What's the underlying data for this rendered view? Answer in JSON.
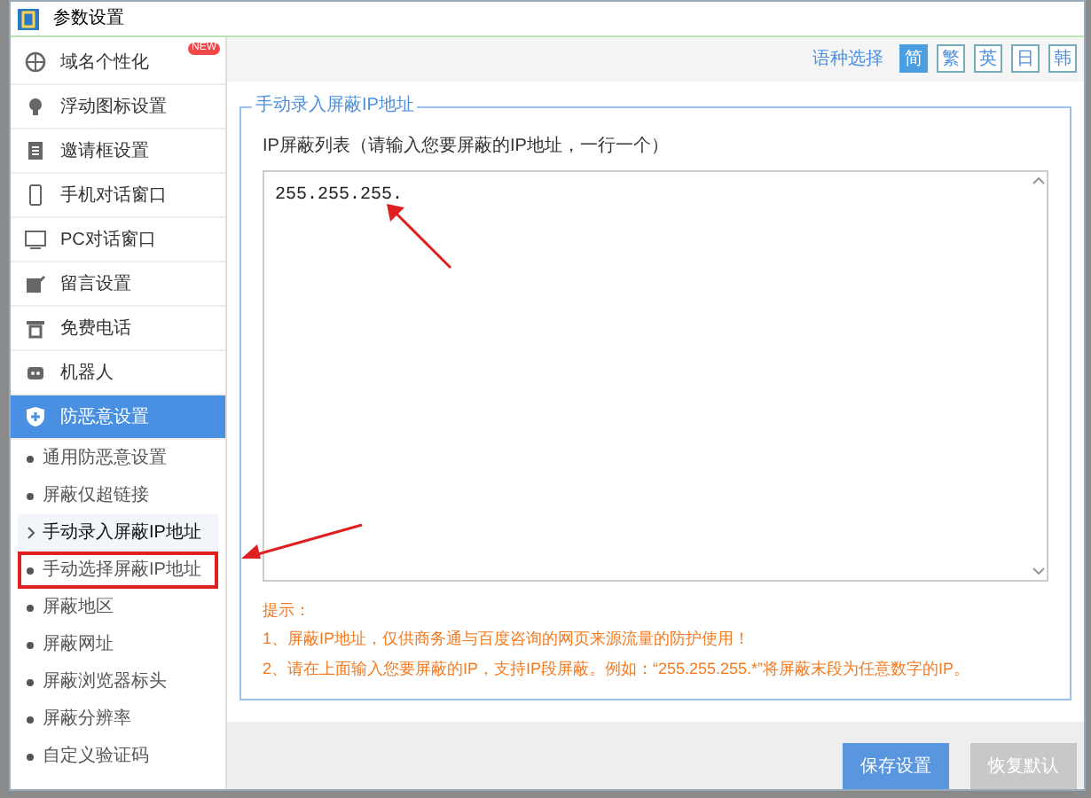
{
  "window": {
    "title": "参数设置"
  },
  "sidebar": {
    "items": [
      {
        "label": "域名个性化",
        "badge": "NEW",
        "expanded": false
      },
      {
        "label": "浮动图标设置",
        "expanded": false
      },
      {
        "label": "邀请框设置",
        "expanded": false
      },
      {
        "label": "手机对话窗口",
        "expanded": false
      },
      {
        "label": "PC对话窗口",
        "expanded": false
      },
      {
        "label": "留言设置",
        "expanded": false
      },
      {
        "label": "免费电话",
        "expanded": false
      },
      {
        "label": "机器人",
        "expanded": false
      },
      {
        "label": "防恶意设置",
        "expanded": true,
        "children": [
          {
            "label": "通用防恶意设置",
            "selected": false,
            "highlighted": false
          },
          {
            "label": "屏蔽仅超链接",
            "selected": false,
            "highlighted": false
          },
          {
            "label": "手动录入屏蔽IP地址",
            "selected": true,
            "highlighted": false
          },
          {
            "label": "手动选择屏蔽IP地址",
            "selected": false,
            "highlighted": true
          },
          {
            "label": "屏蔽地区",
            "selected": false,
            "highlighted": false
          },
          {
            "label": "屏蔽网址",
            "selected": false,
            "highlighted": false
          },
          {
            "label": "屏蔽浏览器标头",
            "selected": false,
            "highlighted": false
          },
          {
            "label": "屏蔽分辨率",
            "selected": false,
            "highlighted": false
          },
          {
            "label": "自定义验证码",
            "selected": false,
            "highlighted": false
          }
        ]
      }
    ]
  },
  "language": {
    "label": "语种选择",
    "options": [
      {
        "label": "简",
        "selected": true
      },
      {
        "label": "繁",
        "selected": false
      },
      {
        "label": "英",
        "selected": false
      },
      {
        "label": "日",
        "selected": false
      },
      {
        "label": "韩",
        "selected": false
      }
    ]
  },
  "section": {
    "title": "手动录入屏蔽IP地址",
    "field_label": "IP屏蔽列表（请输入您要屏蔽的IP地址，一行一个）",
    "value": "255.255.255.",
    "tips_title": "提示：",
    "tips": [
      "1、屏蔽IP地址，仅供商务通与百度咨询的网页来源流量的防护使用！",
      "2、请在上面输入您要屏蔽的IP，支持IP段屏蔽。例如：“255.255.255.*”将屏蔽末段为任意数字的IP。"
    ]
  },
  "buttons": [
    {
      "label": "保存设置",
      "kind": "primary"
    },
    {
      "label": "恢复默认",
      "kind": "secondary"
    }
  ]
}
